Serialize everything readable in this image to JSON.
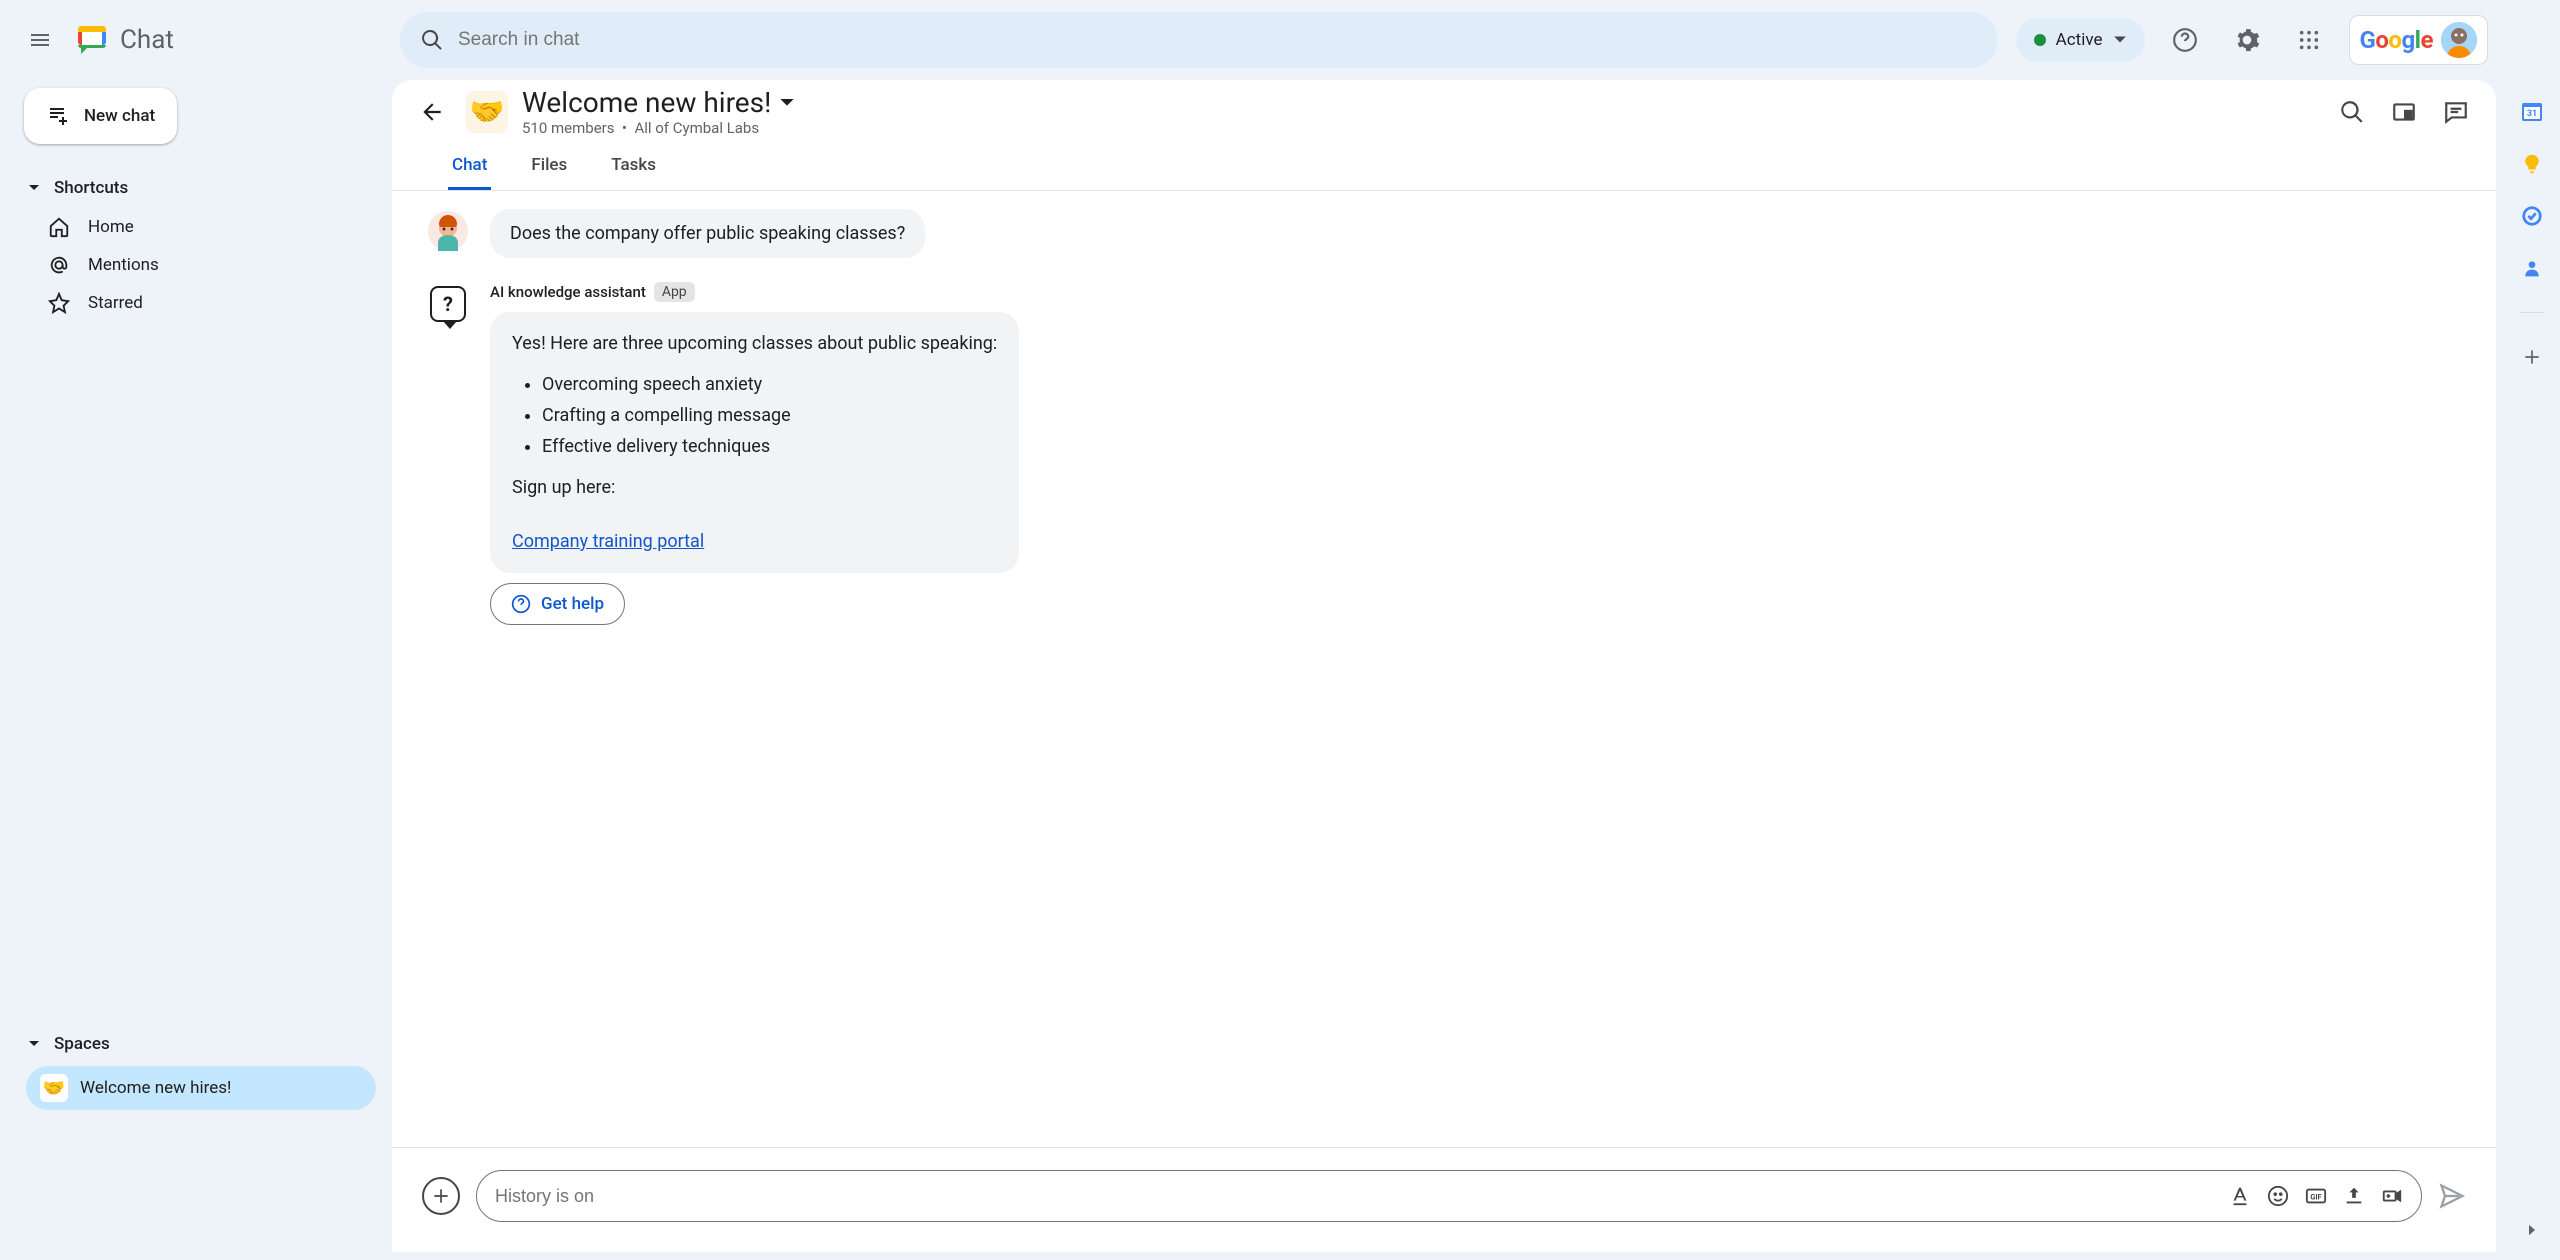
{
  "app": {
    "name": "Chat"
  },
  "search": {
    "placeholder": "Search in chat"
  },
  "status": {
    "label": "Active"
  },
  "newChat": {
    "label": "New chat"
  },
  "shortcuts": {
    "title": "Shortcuts",
    "items": [
      {
        "label": "Home"
      },
      {
        "label": "Mentions"
      },
      {
        "label": "Starred"
      }
    ]
  },
  "spaces": {
    "title": "Spaces",
    "items": [
      {
        "label": "Welcome new hires!",
        "emoji": "🤝"
      }
    ]
  },
  "space": {
    "title": "Welcome new hires!",
    "emoji": "🤝",
    "members": "510 members",
    "org": "All of Cymbal Labs"
  },
  "tabs": [
    {
      "label": "Chat"
    },
    {
      "label": "Files"
    },
    {
      "label": "Tasks"
    }
  ],
  "messages": {
    "user1": {
      "text": "Does the company offer public speaking classes?"
    },
    "ai": {
      "sender": "AI knowledge assistant",
      "badge": "App",
      "intro": "Yes! Here are three upcoming classes about public speaking:",
      "item1": "Overcoming speech anxiety",
      "item2": "Crafting a compelling message",
      "item3": "Effective delivery techniques",
      "signup": "Sign up here:",
      "link": "Company training portal",
      "help": "Get help"
    }
  },
  "composer": {
    "placeholder": "History is on"
  },
  "google": {
    "label": "Google"
  }
}
